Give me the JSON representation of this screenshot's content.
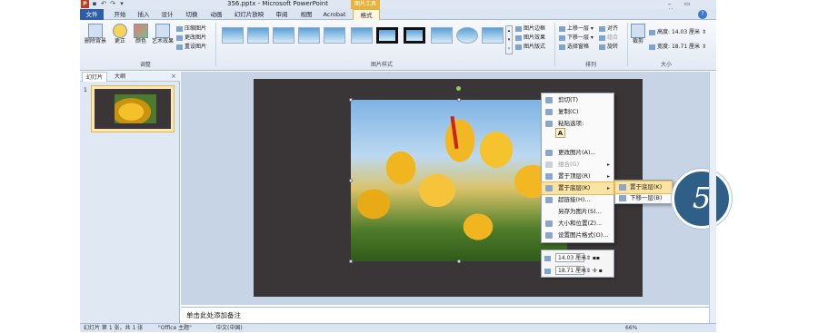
{
  "window": {
    "title": "356.pptx - Microsoft PowerPoint",
    "app_icon": "P",
    "controls": "– ▭ ✕",
    "help": "?"
  },
  "context_tab": {
    "label": "图片工具"
  },
  "quick_access": [
    "save-icon",
    "undo-icon",
    "redo-icon",
    "dropdown-icon"
  ],
  "tabs": [
    {
      "label": "文件"
    },
    {
      "label": "开始"
    },
    {
      "label": "插入"
    },
    {
      "label": "设计"
    },
    {
      "label": "切换"
    },
    {
      "label": "动画"
    },
    {
      "label": "幻灯片放映"
    },
    {
      "label": "审阅"
    },
    {
      "label": "视图"
    },
    {
      "label": "Acrobat"
    },
    {
      "label": "格式"
    }
  ],
  "ribbon": {
    "adjust": {
      "remove_bg": "删除背景",
      "corrections": "更正",
      "color": "颜色",
      "artistic": "艺术效果",
      "compress": "压缩图片",
      "change": "更改图片",
      "reset": "重设图片",
      "group_label": "调整"
    },
    "styles": {
      "border": "图片边框",
      "effects": "图片效果",
      "layout": "图片版式",
      "group_label": "图片样式"
    },
    "arrange": {
      "bring_forward": "上移一层",
      "send_backward": "下移一层",
      "selection_pane": "选择窗格",
      "align": "对齐",
      "group": "组合",
      "rotate": "旋转",
      "group_label": "排列"
    },
    "size": {
      "crop": "裁剪",
      "height_label": "高度:",
      "height_value": "14.03 厘米",
      "width_label": "宽度:",
      "width_value": "18.71 厘米",
      "group_label": "大小"
    }
  },
  "left_pane": {
    "tab_slides": "幻灯片",
    "tab_outline": "大纲",
    "close": "×",
    "slide_number": "1"
  },
  "context_menu": [
    {
      "label": "剪切(T)",
      "disabled": false,
      "has_sub": false
    },
    {
      "label": "复制(C)",
      "disabled": false,
      "has_sub": false
    },
    {
      "label": "粘贴选项:",
      "disabled": false,
      "has_sub": false
    },
    {
      "label": "",
      "disabled": false,
      "has_sub": false
    },
    {
      "label": "更改图片(A)...",
      "disabled": false,
      "has_sub": false
    },
    {
      "label": "组合(G)",
      "disabled": true,
      "has_sub": true
    },
    {
      "label": "置于顶层(R)",
      "disabled": false,
      "has_sub": true
    },
    {
      "label": "置于底层(K)",
      "disabled": false,
      "has_sub": true
    },
    {
      "label": "超链接(H)...",
      "disabled": false,
      "has_sub": false
    },
    {
      "label": "另存为图片(S)...",
      "disabled": false,
      "has_sub": false
    },
    {
      "label": "大小和位置(Z)...",
      "disabled": false,
      "has_sub": false
    },
    {
      "label": "设置图片格式(O)...",
      "disabled": false,
      "has_sub": false
    }
  ],
  "paste_option": "A",
  "submenu": [
    {
      "label": "置于底层(K)"
    },
    {
      "label": "下移一层(B)"
    }
  ],
  "minibar": {
    "height": "14.03 厘米",
    "width": "18.71 厘米"
  },
  "step_badge": "5",
  "notes": {
    "placeholder": "单击此处添加备注"
  },
  "status": {
    "slide": "幻灯片 第 1 张，共 1 张",
    "theme": "\"Office 主题\"",
    "language": "中文(中国)",
    "zoom": "66%"
  }
}
